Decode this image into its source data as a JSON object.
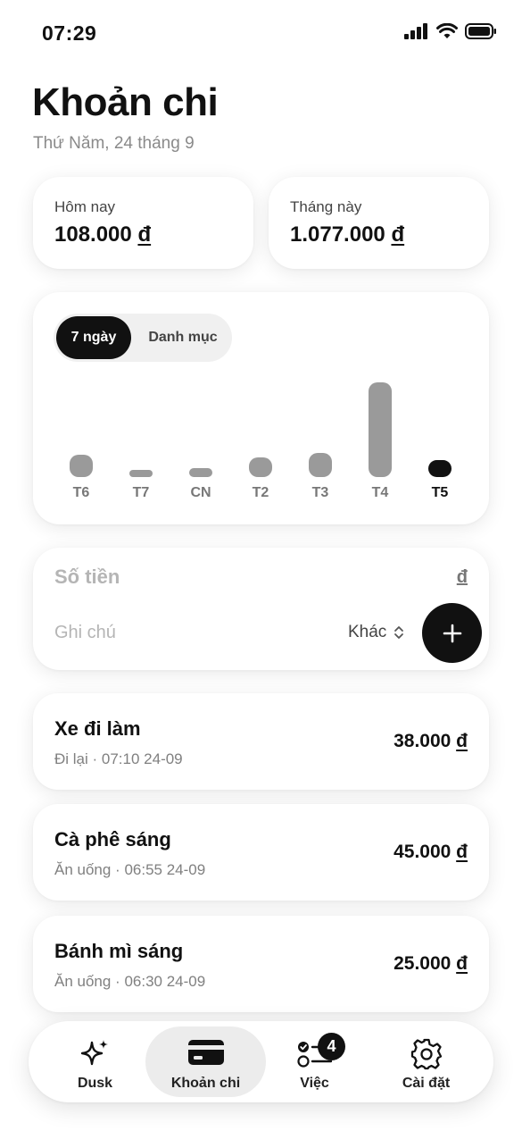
{
  "status_bar": {
    "time": "07:29",
    "icons": [
      "cellular-signal-icon",
      "wifi-icon",
      "battery-icon"
    ]
  },
  "header": {
    "title": "Khoản chi",
    "date": "Thứ Năm, 24 tháng 9"
  },
  "summary": {
    "today": {
      "label": "Hôm nay",
      "amount": "108.000",
      "currency": "đ"
    },
    "month": {
      "label": "Tháng này",
      "amount": "1.077.000",
      "currency": "đ"
    }
  },
  "chart_segment": {
    "options": [
      "7 ngày",
      "Danh mục"
    ],
    "selected": "7 ngày"
  },
  "chart_data": {
    "type": "bar",
    "categories": [
      "T6",
      "T7",
      "CN",
      "T2",
      "T3",
      "T4",
      "T5"
    ],
    "values": [
      25,
      5,
      10,
      22,
      28,
      108,
      19
    ],
    "highlight_index": 6,
    "ylim": [
      0,
      110
    ],
    "grid": false,
    "title": "",
    "xlabel": "",
    "ylabel": ""
  },
  "entry_form": {
    "amount_placeholder": "Số tiền",
    "currency": "đ",
    "note_placeholder": "Ghi chú",
    "category": "Khác",
    "add_icon": "plus-icon"
  },
  "expenses": [
    {
      "name": "Xe đi làm",
      "meta": "Đi lại · 07:10 24-09",
      "amount": "38.000",
      "currency": "đ"
    },
    {
      "name": "Cà phê sáng",
      "meta": "Ăn uống · 06:55 24-09",
      "amount": "45.000",
      "currency": "đ"
    },
    {
      "name": "Bánh mì sáng",
      "meta": "Ăn uống · 06:30 24-09",
      "amount": "25.000",
      "currency": "đ"
    }
  ],
  "tabbar": {
    "tabs": [
      {
        "label": "Dusk",
        "icon": "sparkles-icon",
        "active": false
      },
      {
        "label": "Khoản chi",
        "icon": "credit-card-icon",
        "active": true
      },
      {
        "label": "Việc",
        "icon": "checklist-icon",
        "active": false,
        "badge": "4"
      },
      {
        "label": "Cài đặt",
        "icon": "gear-icon",
        "active": false
      }
    ]
  },
  "colors": {
    "primary": "#111111",
    "bar": "#9a9a9a",
    "muted_text": "#8a8a8a",
    "card_bg": "#ffffff"
  }
}
